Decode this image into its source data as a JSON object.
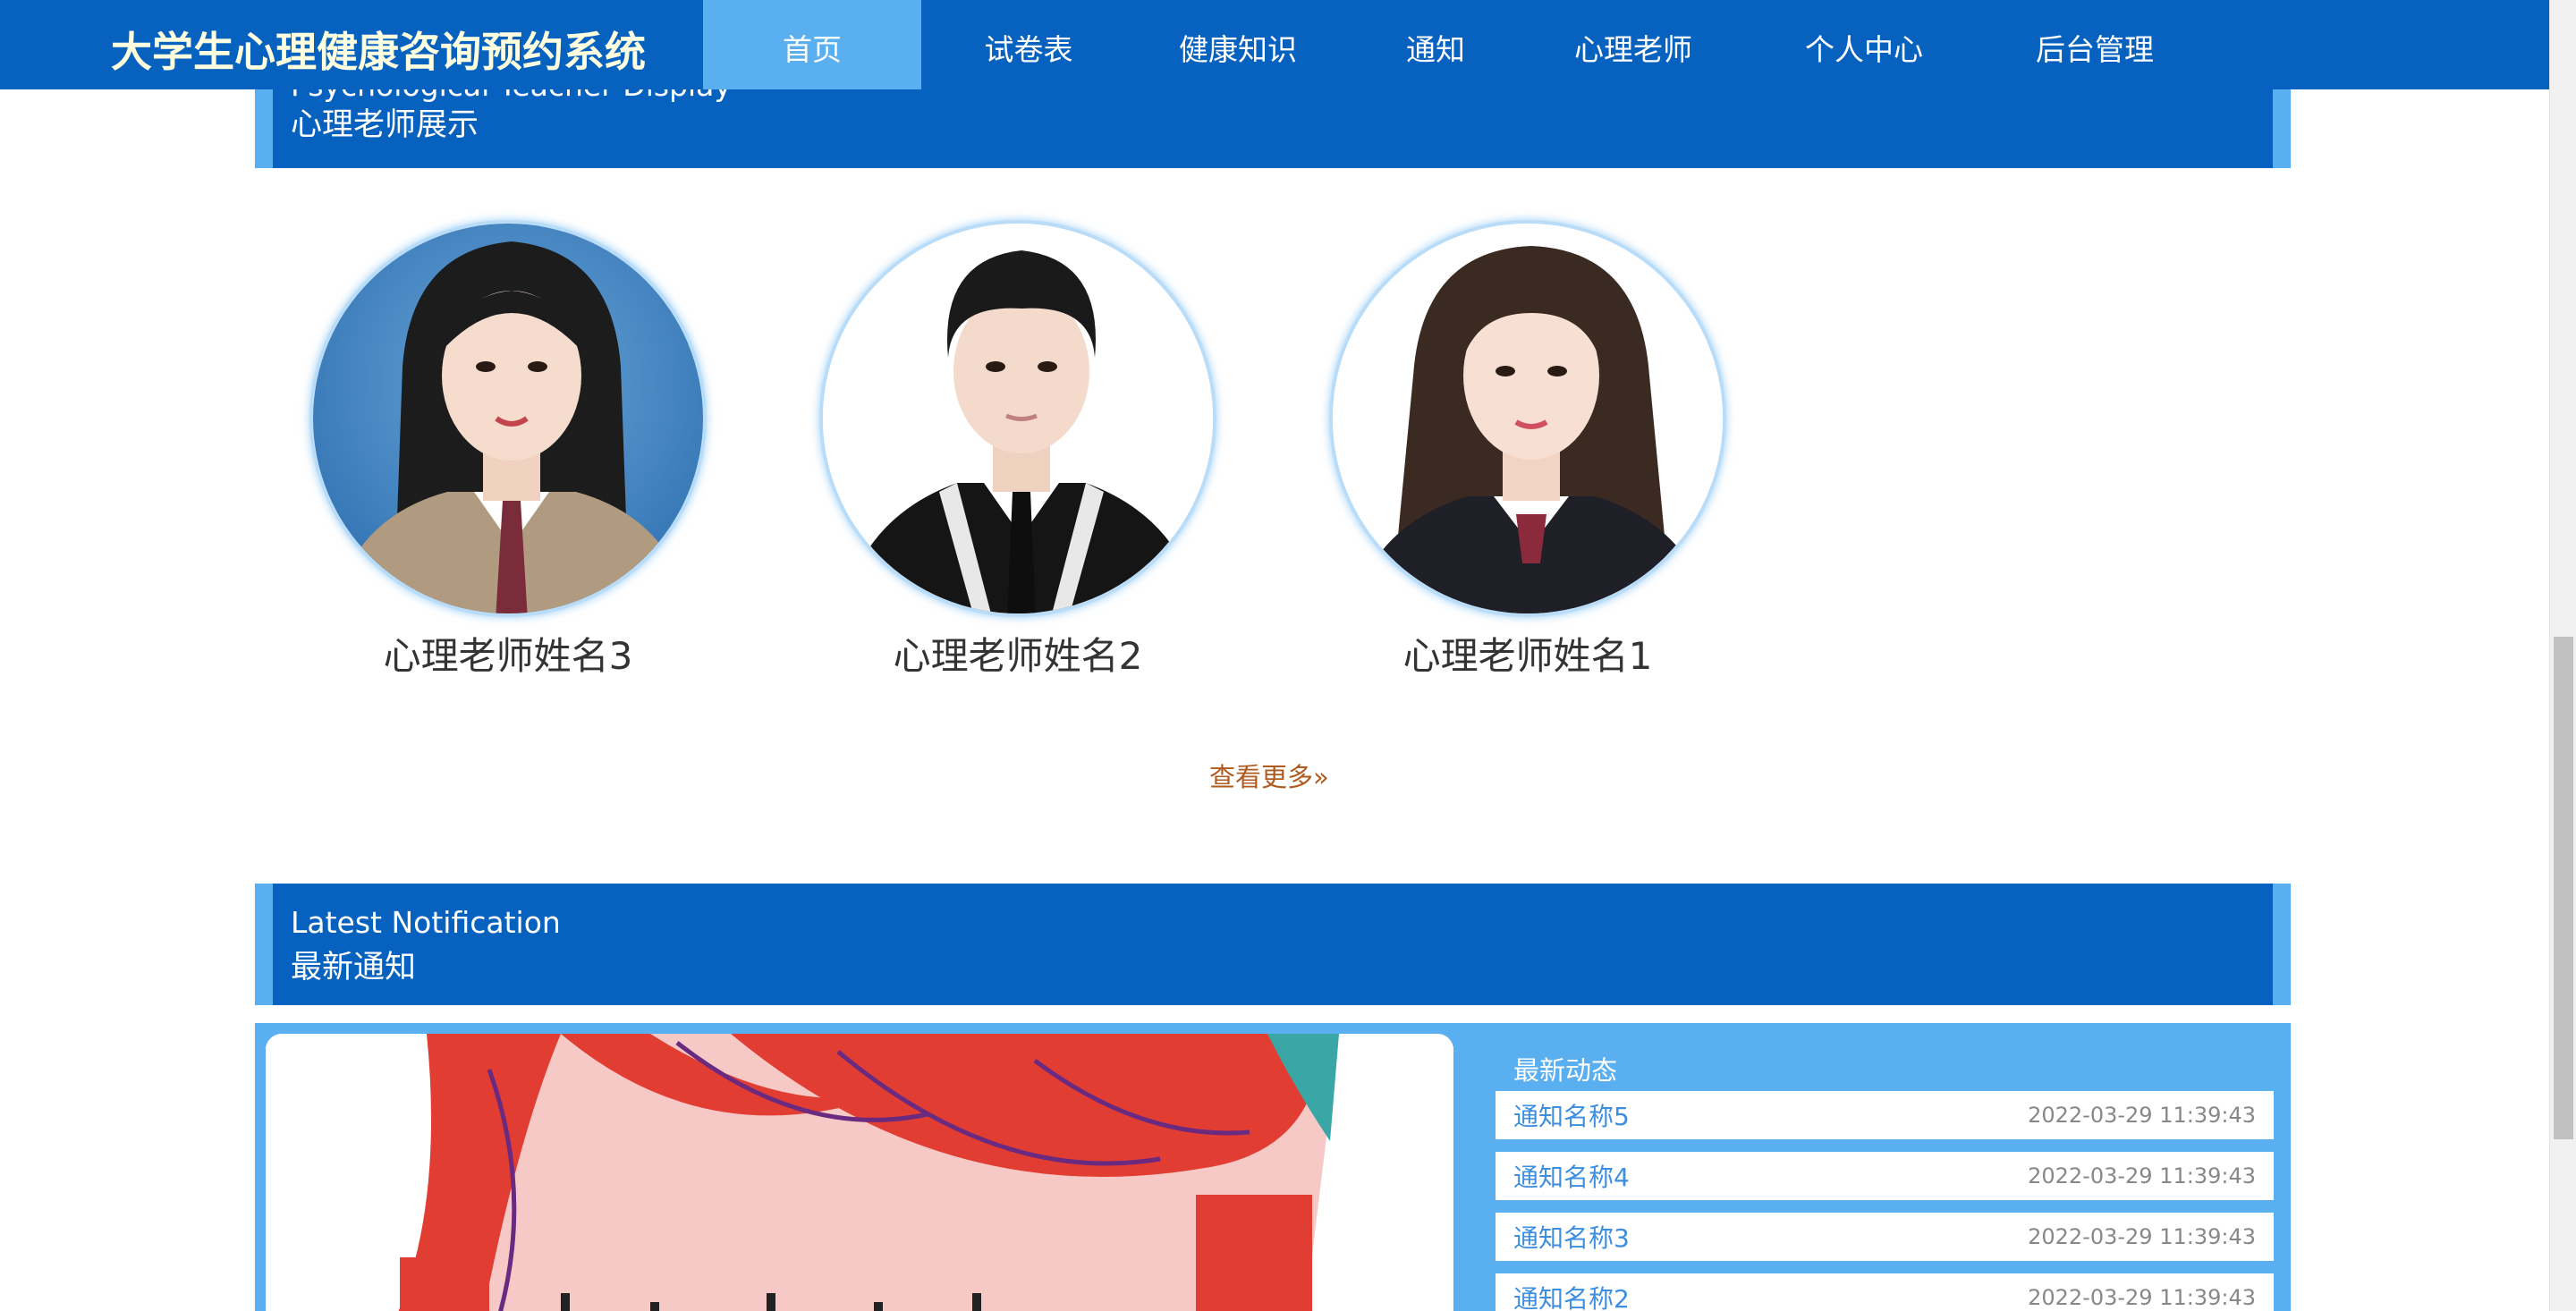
{
  "app_title": "大学生心理健康咨询预约系统",
  "nav": {
    "items": [
      {
        "label": "首页",
        "active": true
      },
      {
        "label": "试卷表",
        "active": false
      },
      {
        "label": "健康知识",
        "active": false
      },
      {
        "label": "通知",
        "active": false
      },
      {
        "label": "心理老师",
        "active": false
      },
      {
        "label": "个人中心",
        "active": false
      },
      {
        "label": "后台管理",
        "active": false
      }
    ]
  },
  "teacher_section": {
    "title_en": "Psychological Teacher Display",
    "title_cn": "心理老师展示",
    "teachers": [
      {
        "name": "心理老师姓名3"
      },
      {
        "name": "心理老师姓名2"
      },
      {
        "name": "心理老师姓名1"
      }
    ],
    "more_label": "查看更多»"
  },
  "notice_section": {
    "title_en": "Latest Notification",
    "title_cn": "最新通知",
    "list_title": "最新动态",
    "items": [
      {
        "name": "通知名称5",
        "time": "2022-03-29 11:39:43"
      },
      {
        "name": "通知名称4",
        "time": "2022-03-29 11:39:43"
      },
      {
        "name": "通知名称3",
        "time": "2022-03-29 11:39:43"
      },
      {
        "name": "通知名称2",
        "time": "2022-03-29 11:39:43"
      }
    ]
  },
  "colors": {
    "primary": "#0762bf",
    "accent": "#5aaff0",
    "title_text": "#ffffe0",
    "more_link": "#b05a1e"
  }
}
